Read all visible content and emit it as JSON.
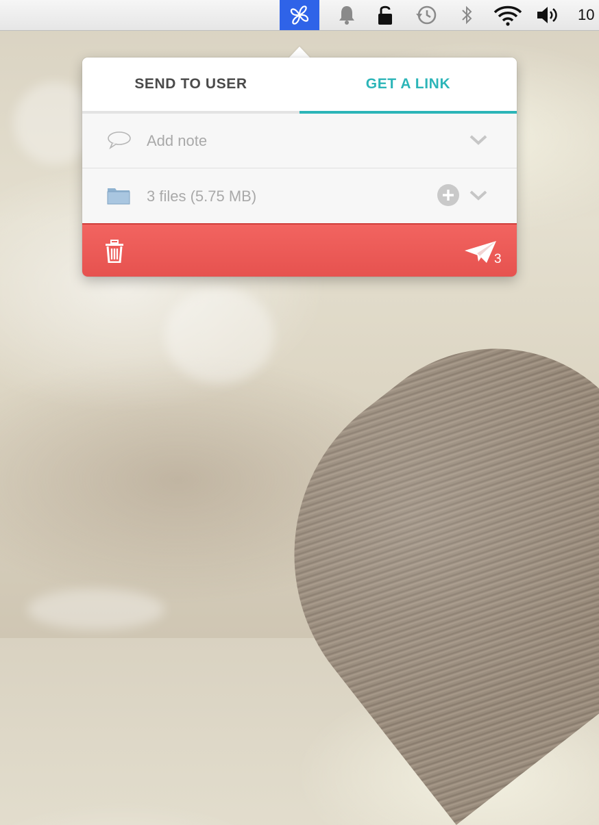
{
  "menubar": {
    "items": [
      {
        "name": "app-icon",
        "icon": "propeller-icon"
      },
      {
        "name": "notifications",
        "icon": "bell-icon"
      },
      {
        "name": "lock",
        "icon": "lock-icon"
      },
      {
        "name": "time-machine",
        "icon": "clock-history-icon"
      },
      {
        "name": "bluetooth",
        "icon": "bluetooth-icon"
      },
      {
        "name": "wifi",
        "icon": "wifi-icon"
      },
      {
        "name": "volume",
        "icon": "speaker-icon"
      }
    ],
    "clock_text": "10"
  },
  "popover": {
    "tabs": [
      {
        "label": "SEND TO USER",
        "active": false
      },
      {
        "label": "GET A LINK",
        "active": true
      }
    ],
    "note": {
      "placeholder": "Add note",
      "icon": "speech-bubble-icon"
    },
    "files": {
      "label": "3 files (5.75 MB)",
      "icon": "folder-icon"
    },
    "footer": {
      "send_count": "3"
    }
  },
  "colors": {
    "accent_teal": "#2cb5b8",
    "footer_red": "#f26460",
    "menubar_highlight": "#2f63e8"
  }
}
